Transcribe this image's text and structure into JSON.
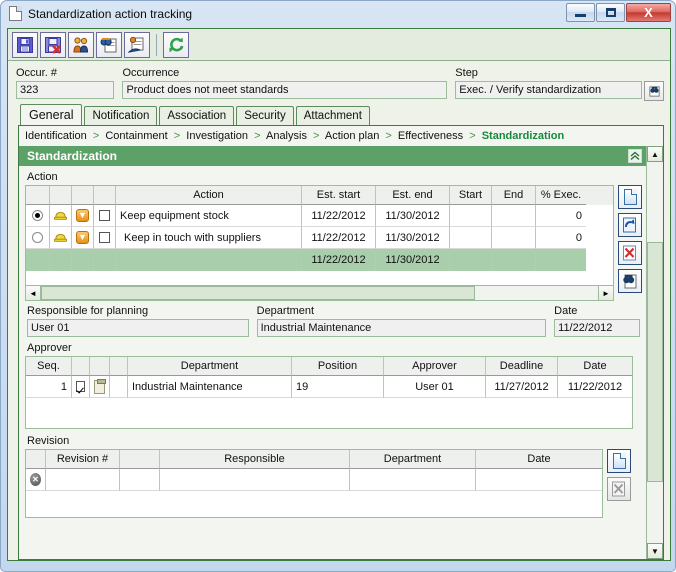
{
  "window": {
    "title": "Standardization action tracking",
    "minimize_label": "Minimize",
    "maximize_label": "Maximize",
    "close_label": "X"
  },
  "toolbar": {
    "buttons": [
      {
        "name": "save",
        "label": "Save"
      },
      {
        "name": "save-and-close",
        "label": "Save and close"
      },
      {
        "name": "team",
        "label": "Team"
      },
      {
        "name": "find-document",
        "label": "Find document"
      },
      {
        "name": "send",
        "label": "Send"
      },
      {
        "name": "refresh",
        "label": "Refresh"
      }
    ]
  },
  "header_fields": {
    "occurrence_number": {
      "label": "Occur. #",
      "value": "323"
    },
    "occurrence": {
      "label": "Occurrence",
      "value": "Product does not meet standards"
    },
    "step": {
      "label": "Step",
      "value": "Exec. / Verify standardization"
    }
  },
  "tabs": [
    {
      "label": "General",
      "active": true
    },
    {
      "label": "Notification",
      "active": false
    },
    {
      "label": "Association",
      "active": false
    },
    {
      "label": "Security",
      "active": false
    },
    {
      "label": "Attachment",
      "active": false
    }
  ],
  "breadcrumb": {
    "items": [
      "Identification",
      "Containment",
      "Investigation",
      "Analysis",
      "Action plan",
      "Effectiveness"
    ],
    "current": "Standardization",
    "separator": ">"
  },
  "panel": {
    "title": "Standardization"
  },
  "action_section": {
    "label": "Action",
    "columns": [
      "",
      "",
      "",
      "",
      "Action",
      "Est. start",
      "Est. end",
      "Start",
      "End",
      "% Exec."
    ],
    "rows": [
      {
        "selected": true,
        "checked": false,
        "action": "Keep equipment stock",
        "est_start": "11/22/2012",
        "est_end": "11/30/2012",
        "start": "",
        "end": "",
        "pct_exec": "0"
      },
      {
        "selected": false,
        "checked": false,
        "action": "Keep in touch with suppliers",
        "est_start": "11/22/2012",
        "est_end": "11/30/2012",
        "start": "",
        "end": "",
        "pct_exec": "0"
      }
    ],
    "total_row": {
      "action": "",
      "est_start": "11/22/2012",
      "est_end": "11/30/2012",
      "start": "",
      "end": "",
      "pct_exec": ""
    },
    "side_buttons": [
      {
        "name": "new-action",
        "label": "New"
      },
      {
        "name": "edit-action",
        "label": "Edit"
      },
      {
        "name": "delete-action",
        "label": "Delete"
      },
      {
        "name": "search-action",
        "label": "Search"
      }
    ]
  },
  "planning": {
    "responsible": {
      "label": "Responsible for planning",
      "value": "User 01"
    },
    "department": {
      "label": "Department",
      "value": "Industrial Maintenance"
    },
    "date": {
      "label": "Date",
      "value": "11/22/2012"
    }
  },
  "approver_section": {
    "label": "Approver",
    "columns": [
      "Seq.",
      "",
      "",
      "",
      "Department",
      "Position",
      "Approver",
      "Deadline",
      "Date"
    ],
    "rows": [
      {
        "seq": "1",
        "checked": true,
        "department": "Industrial Maintenance",
        "position": "19",
        "approver": "User 01",
        "deadline": "11/27/2012",
        "date": "11/22/2012"
      }
    ]
  },
  "revision_section": {
    "label": "Revision",
    "columns": [
      "",
      "Revision #",
      "",
      "Responsible",
      "Department",
      "Date"
    ],
    "rows": [
      {
        "revision_number": "",
        "responsible": "",
        "department": "",
        "date": ""
      }
    ],
    "side_buttons": [
      {
        "name": "new-revision",
        "label": "New"
      },
      {
        "name": "delete-revision",
        "label": "Delete"
      }
    ]
  },
  "scrollbars": {
    "vertical_up": "▲",
    "vertical_down": "▼",
    "horizontal_left": "◄",
    "horizontal_right": "►"
  },
  "colors": {
    "panel_header": "#5ca268",
    "accent_green": "#3d7a3d",
    "breadcrumb_current": "#168a3c",
    "total_row": "#a9ceab"
  }
}
